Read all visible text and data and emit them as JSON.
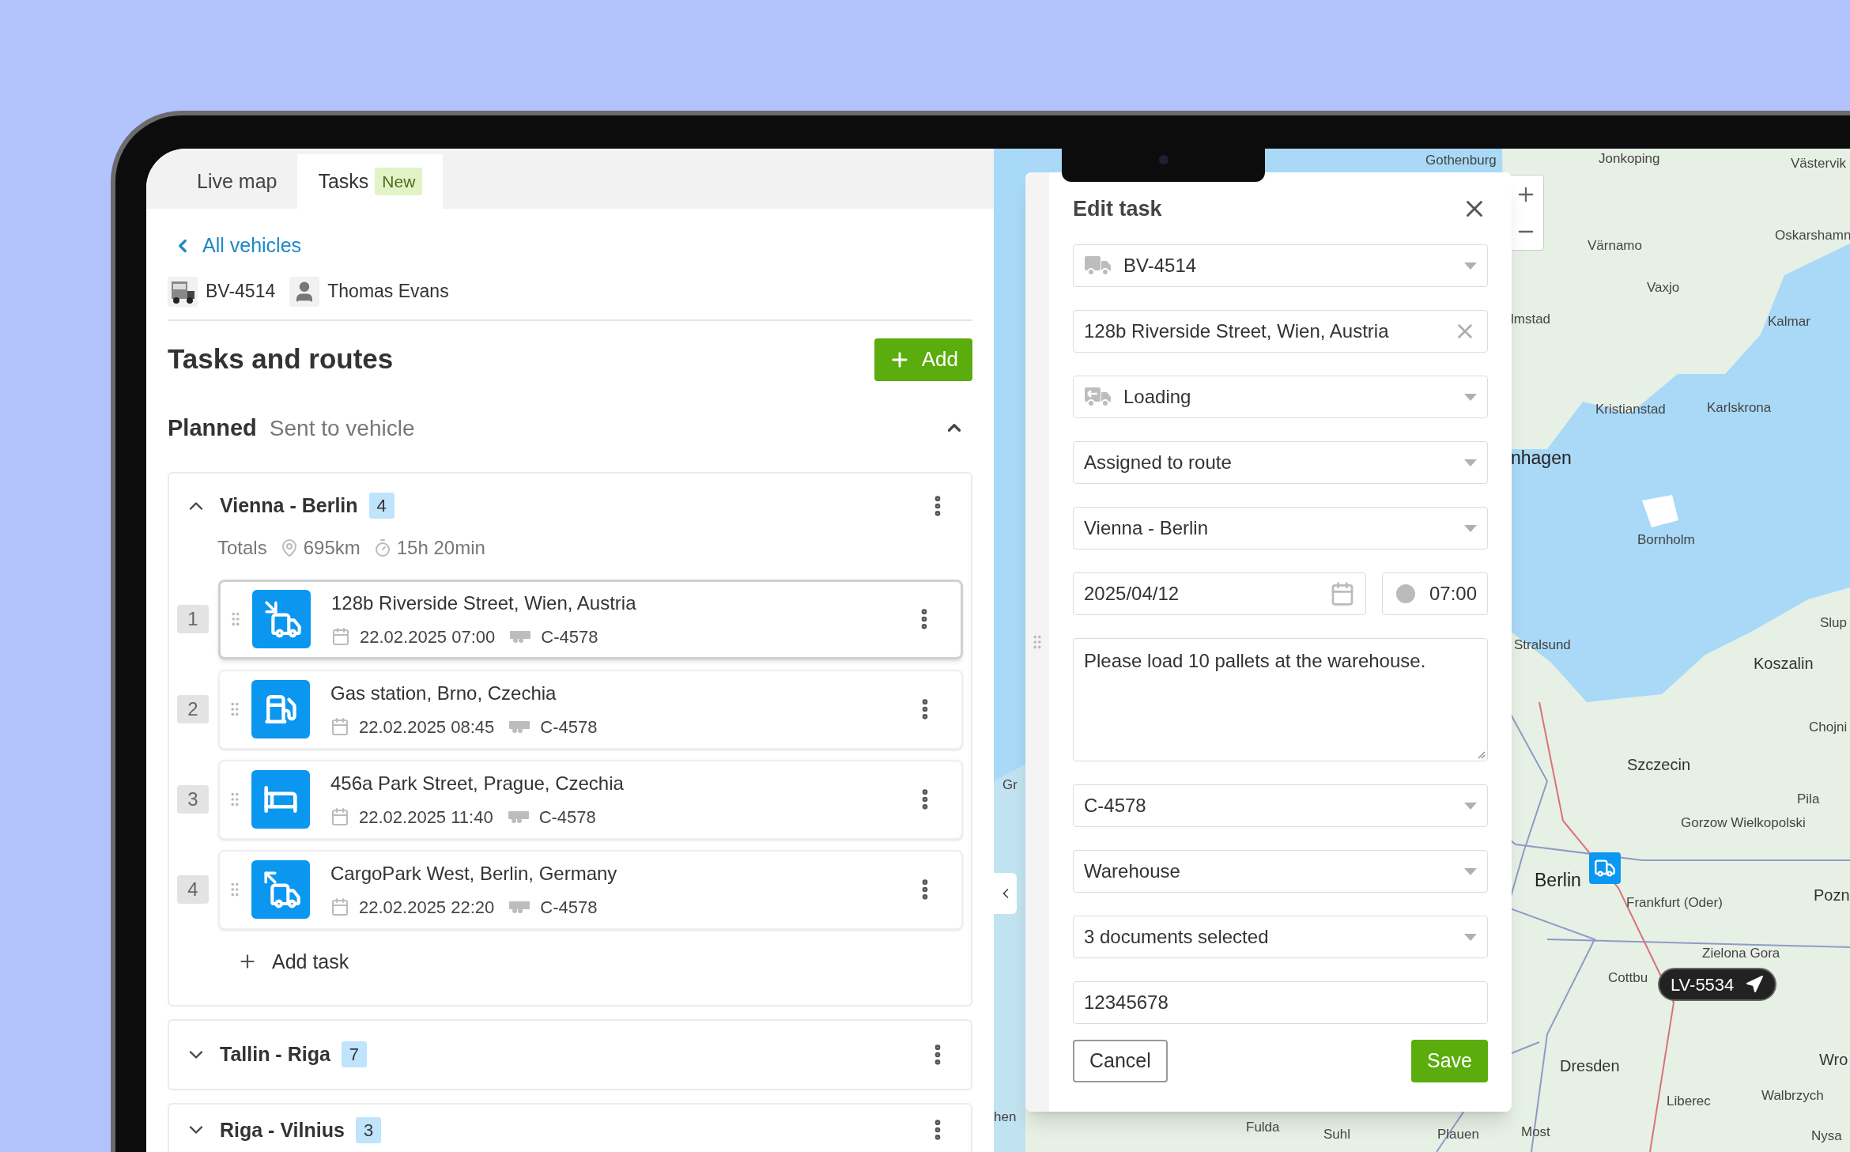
{
  "tabs": [
    {
      "label": "Live map",
      "selected": false
    },
    {
      "label": "Tasks",
      "selected": true,
      "badge": "New"
    }
  ],
  "back_link": "All vehicles",
  "vehicle": {
    "plate": "BV-4514",
    "driver": "Thomas Evans"
  },
  "header": {
    "title": "Tasks and routes",
    "add_button": "Add"
  },
  "section": {
    "title": "Planned",
    "subtitle": "Sent to vehicle",
    "expanded": true
  },
  "routes": [
    {
      "name": "Vienna - Berlin",
      "count": "4",
      "expanded": true,
      "totals_label": "Totals",
      "distance": "695km",
      "duration": "15h 20min",
      "add_task": "Add task",
      "tasks": [
        {
          "number": "1",
          "kind": "loading",
          "address": "128b Riverside Street, Wien, Austria",
          "datetime": "22.02.2025 07:00",
          "trailer": "C-4578",
          "selected": true
        },
        {
          "number": "2",
          "kind": "fuel",
          "address": "Gas station, Brno, Czechia",
          "datetime": "22.02.2025 08:45",
          "trailer": "C-4578",
          "selected": false
        },
        {
          "number": "3",
          "kind": "rest",
          "address": "456a Park Street, Prague, Czechia",
          "datetime": "22.02.2025 11:40",
          "trailer": "C-4578",
          "selected": false
        },
        {
          "number": "4",
          "kind": "unloading",
          "address": "CargoPark West, Berlin, Germany",
          "datetime": "22.02.2025 22:20",
          "trailer": "C-4578",
          "selected": false
        }
      ]
    },
    {
      "name": "Tallin - Riga",
      "count": "7",
      "expanded": false
    },
    {
      "name": "Riga - Vilnius",
      "count": "3",
      "expanded": false
    }
  ],
  "dialog": {
    "title": "Edit task",
    "fields": [
      {
        "kind": "vehicle_select",
        "value": "BV-4514"
      },
      {
        "kind": "address",
        "value": "128b Riverside Street, Wien, Austria"
      },
      {
        "kind": "type_select",
        "value": "Loading"
      },
      {
        "kind": "select",
        "value": "Assigned to route"
      },
      {
        "kind": "select",
        "value": "Vienna - Berlin"
      },
      {
        "kind": "datetime",
        "date": "2025/04/12",
        "time": "07:00"
      },
      {
        "kind": "textarea",
        "value": "Please load 10 pallets at the warehouse."
      },
      {
        "kind": "select",
        "value": "C-4578"
      },
      {
        "kind": "select",
        "value": "Warehouse"
      },
      {
        "kind": "select",
        "value": "3 documents selected"
      },
      {
        "kind": "input",
        "value": "12345678"
      }
    ],
    "cancel": "Cancel",
    "save": "Save"
  },
  "map": {
    "labels": [
      {
        "text": "Gothenburg",
        "kind": "minor"
      },
      {
        "text": "Jonkoping",
        "kind": "minor"
      },
      {
        "text": "Västervik",
        "kind": "minor"
      },
      {
        "text": "Värnamo",
        "kind": "minor"
      },
      {
        "text": "Oskarshamn",
        "kind": "minor"
      },
      {
        "text": "Vaxjo",
        "kind": "minor"
      },
      {
        "text": "lmstad",
        "kind": "minor"
      },
      {
        "text": "Kalmar",
        "kind": "minor"
      },
      {
        "text": "Kristianstad",
        "kind": "minor"
      },
      {
        "text": "Karlskrona",
        "kind": "minor"
      },
      {
        "text": "nhagen",
        "kind": "major"
      },
      {
        "text": "Bornholm",
        "kind": "minor"
      },
      {
        "text": "Slup",
        "kind": "minor"
      },
      {
        "text": "Stralsund",
        "kind": "minor"
      },
      {
        "text": "Koszalin",
        "kind": "medium"
      },
      {
        "text": "Chojni",
        "kind": "minor"
      },
      {
        "text": "Szczecin",
        "kind": "medium"
      },
      {
        "text": "Gr",
        "kind": "minor"
      },
      {
        "text": "Pila",
        "kind": "minor"
      },
      {
        "text": "Gorzow Wielkopolski",
        "kind": "minor"
      },
      {
        "text": "Berlin",
        "kind": "major"
      },
      {
        "text": "Frankfurt (Oder)",
        "kind": "minor"
      },
      {
        "text": "Pozn",
        "kind": "medium"
      },
      {
        "text": "Zielona Gora",
        "kind": "minor"
      },
      {
        "text": "Cottbu",
        "kind": "minor"
      },
      {
        "text": "Dresden",
        "kind": "medium"
      },
      {
        "text": "Wro",
        "kind": "medium"
      },
      {
        "text": "Liberec",
        "kind": "minor"
      },
      {
        "text": "Walbrzych",
        "kind": "minor"
      },
      {
        "text": "hen",
        "kind": "minor"
      },
      {
        "text": "Fulda",
        "kind": "minor"
      },
      {
        "text": "Suhl",
        "kind": "minor"
      },
      {
        "text": "Plauen",
        "kind": "minor"
      },
      {
        "text": "Most",
        "kind": "minor"
      },
      {
        "text": "Nysa",
        "kind": "minor"
      }
    ],
    "marker_label": "LV-5534"
  }
}
